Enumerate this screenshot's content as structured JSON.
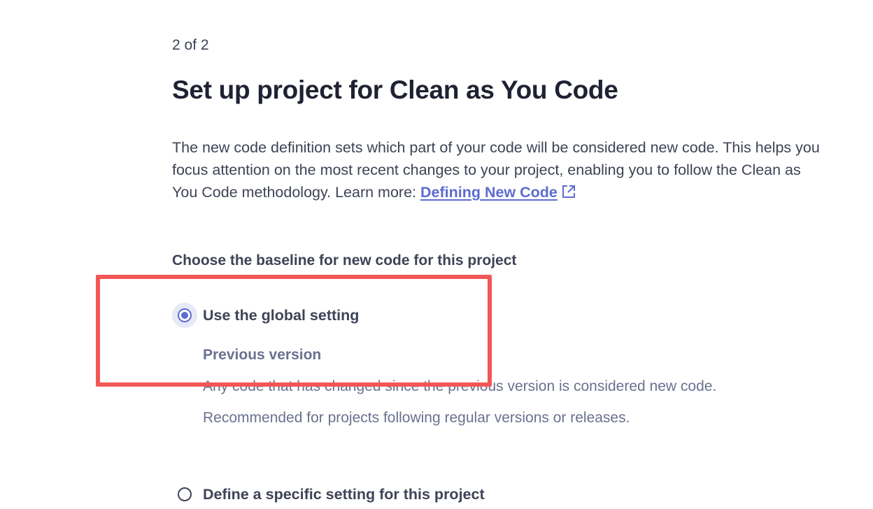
{
  "step_indicator": "2 of 2",
  "page_title": "Set up project for Clean as You Code",
  "description": {
    "line1": "The new code definition sets which part of your code will be considered new code. This helps you",
    "line2": "focus attention on the most recent changes to your project, enabling you to follow the Clean as",
    "line3_prefix": "You Code methodology. Learn more: ",
    "link_label": "Defining New Code",
    "link_icon": "external-link-icon"
  },
  "baseline": {
    "heading": "Choose the baseline for new code for this project",
    "options": [
      {
        "label": "Use the global setting",
        "selected": true,
        "detail_title": "Previous version",
        "detail_line1": "Any code that has changed since the previous version is considered new code.",
        "detail_line2": "Recommended for projects following regular versions or releases."
      },
      {
        "label": "Define a specific setting for this project",
        "selected": false
      }
    ]
  },
  "colors": {
    "accent": "#5d6cd0",
    "highlight": "#f35656",
    "text": "#3e4356",
    "muted": "#6a7190"
  }
}
